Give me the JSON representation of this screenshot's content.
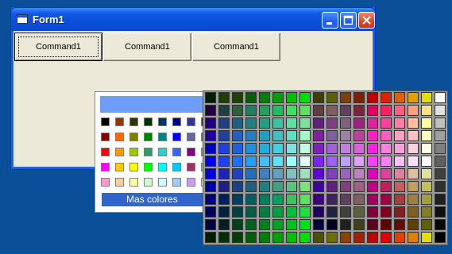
{
  "window": {
    "title": "Form1"
  },
  "buttons": [
    "Command1",
    "Command1",
    "Command1"
  ],
  "popup": {
    "selected_color": "#6e9cf9",
    "swatches": [
      [
        "#000000",
        "#993300",
        "#333300",
        "#003300",
        "#003366",
        "#000080",
        "#333399",
        "#333333"
      ],
      [
        "#800000",
        "#ff6600",
        "#808000",
        "#008000",
        "#008080",
        "#0000ff",
        "#666699",
        "#808080"
      ],
      [
        "#ff0000",
        "#ff9900",
        "#99cc00",
        "#339966",
        "#33cccc",
        "#3366ff",
        "#800080",
        "#969696"
      ],
      [
        "#ff00ff",
        "#ffcc00",
        "#ffff00",
        "#00ff00",
        "#00ffff",
        "#00ccff",
        "#993366",
        "#c0c0c0"
      ],
      [
        "#ff99cc",
        "#ffcc99",
        "#ffff99",
        "#ccffcc",
        "#ccffff",
        "#99ccff",
        "#cc99ff",
        "#ffffff"
      ]
    ],
    "more_label": "Mas colores"
  },
  "grid": {
    "rows": 12,
    "cols": 18,
    "row_colors": [
      [
        "#001f00",
        "#1f3f00",
        "#204000",
        "#005f00",
        "#007f00",
        "#00a000",
        "#00c000",
        "#00e000",
        "#3f3f00",
        "#5f5f00",
        "#7f4000",
        "#7f2000",
        "#c00000",
        "#e02000",
        "#e06000",
        "#e0a000",
        "#e0e000",
        "#ffffff"
      ],
      [
        "#20003f",
        "#203f3f",
        "#2f5f3f",
        "#207f5f",
        "#20a05f",
        "#20c060",
        "#40e060",
        "#60e060",
        "#5f3f3f",
        "#7f5f5f",
        "#5f405f",
        "#7f203f",
        "#e0005f",
        "#ff205f",
        "#ff607f",
        "#ffa07f",
        "#ffe07f",
        "#e0e0e0"
      ],
      [
        "#20007f",
        "#20407f",
        "#20607f",
        "#20807f",
        "#20a080",
        "#40c0a0",
        "#60e0a0",
        "#80e0a0",
        "#5f207f",
        "#7f407f",
        "#7f607f",
        "#a0207f",
        "#e0209f",
        "#ff409f",
        "#ff80a0",
        "#ffc0a0",
        "#ffffa0",
        "#c0c0c0"
      ],
      [
        "#1f00a0",
        "#2040a0",
        "#2060c0",
        "#2080c0",
        "#20a0c0",
        "#40c0c0",
        "#60e0c0",
        "#a0ffc0",
        "#7f20a0",
        "#7f60a0",
        "#a080a0",
        "#c040a0",
        "#ff20c0",
        "#ff60c0",
        "#ffa0c0",
        "#ffc0c0",
        "#ffffc0",
        "#a0a0a0"
      ],
      [
        "#0000c0",
        "#2040e0",
        "#2060e0",
        "#2090e0",
        "#20b0e0",
        "#40d0e0",
        "#80e0e0",
        "#c0ffe0",
        "#8020c0",
        "#a060e0",
        "#c080e0",
        "#e060e0",
        "#ff20e0",
        "#ff80e0",
        "#ffa0e0",
        "#ffd0e0",
        "#ffffe0",
        "#808080"
      ],
      [
        "#0000ff",
        "#2040ff",
        "#2070ff",
        "#20a0ff",
        "#40c0ff",
        "#60e0ff",
        "#a0ffff",
        "#e0ffff",
        "#8020ff",
        "#a060ff",
        "#c0a0ff",
        "#e0a0ff",
        "#ff40ff",
        "#ff80ff",
        "#ffc0ff",
        "#ffe0ff",
        "#ffffff",
        "#606060"
      ],
      [
        "#0000e0",
        "#1f20c0",
        "#2040c0",
        "#2070c0",
        "#4080c0",
        "#60a0c0",
        "#80c0c0",
        "#a0e0c0",
        "#6000e0",
        "#8040c0",
        "#a060c0",
        "#c080c0",
        "#e000c0",
        "#e040a0",
        "#e080a0",
        "#e0c0a0",
        "#e0e0a0",
        "#404040"
      ],
      [
        "#0000a0",
        "#1f2080",
        "#1f4080",
        "#205f80",
        "#208080",
        "#40a080",
        "#60c080",
        "#80e080",
        "#4000a0",
        "#602080",
        "#804080",
        "#a06080",
        "#c00080",
        "#c02060",
        "#c06060",
        "#c0a060",
        "#c0c060",
        "#303030"
      ],
      [
        "#00007f",
        "#001f5f",
        "#003f5f",
        "#005f5f",
        "#007f5f",
        "#00a060",
        "#40c060",
        "#60e060",
        "#3f007f",
        "#40205f",
        "#60405f",
        "#80605f",
        "#a0005f",
        "#a00040",
        "#a04040",
        "#a08040",
        "#a0a040",
        "#202020"
      ],
      [
        "#00005f",
        "#00203f",
        "#00403f",
        "#00603f",
        "#00803f",
        "#00a040",
        "#00c040",
        "#20e040",
        "#20005f",
        "#20203f",
        "#40403f",
        "#60603f",
        "#80003f",
        "#800020",
        "#802020",
        "#806020",
        "#808020",
        "#101010"
      ],
      [
        "#00003f",
        "#00201f",
        "#00401f",
        "#00601f",
        "#00801f",
        "#00a020",
        "#00c020",
        "#00e020",
        "#00003f",
        "#00001f",
        "#20201f",
        "#40401f",
        "#60001f",
        "#600000",
        "#601000",
        "#604000",
        "#606000",
        "#080808"
      ],
      [
        "#001f00",
        "#002f00",
        "#004000",
        "#006000",
        "#008000",
        "#00a000",
        "#00c000",
        "#00e000",
        "#4f4f00",
        "#6f6f00",
        "#8f4000",
        "#a02000",
        "#c00000",
        "#e00000",
        "#e04000",
        "#e08000",
        "#e0e000",
        "#000000"
      ]
    ]
  }
}
